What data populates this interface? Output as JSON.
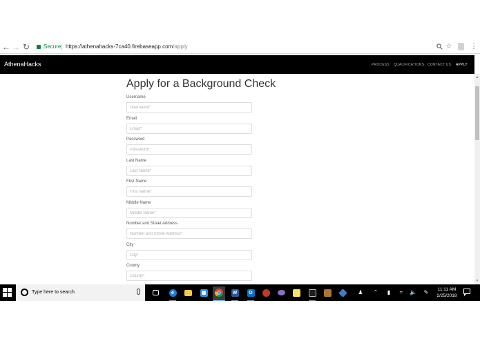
{
  "browser": {
    "back_icon": "arrow-left-icon",
    "forward_icon": "arrow-right-icon",
    "reload_icon": "reload-icon",
    "secure_label": "Secure",
    "url_host": "https://athenahacks-7ca40.firebaseapp.com",
    "url_path": "/apply",
    "zoom_icon": "zoom-icon",
    "bookmark_icon": "star-icon",
    "menu_icon": "kebab-menu-icon"
  },
  "site_nav": {
    "brand": "AthenaHacks",
    "links": [
      "PROCESS",
      "QUALIFICATIONS",
      "CONTACT US",
      "APPLY"
    ],
    "active_link": "APPLY"
  },
  "form": {
    "title": "Apply for a Background Check",
    "fields": [
      {
        "label": "Username",
        "placeholder": "Username*"
      },
      {
        "label": "Email",
        "placeholder": "Email*"
      },
      {
        "label": "Password",
        "placeholder": "Password*"
      },
      {
        "label": "Last Name",
        "placeholder": "Last Name*"
      },
      {
        "label": "First Name",
        "placeholder": "First Name*"
      },
      {
        "label": "Middle Name",
        "placeholder": "Middle Name*"
      },
      {
        "label": "Number and Street Address",
        "placeholder": "Number and Street Address*"
      },
      {
        "label": "City",
        "placeholder": "City*"
      },
      {
        "label": "County",
        "placeholder": "County*"
      }
    ]
  },
  "taskbar": {
    "search_placeholder": "Type here to search",
    "apps": [
      "task-view",
      "edge",
      "file-explorer",
      "store",
      "chrome",
      "word",
      "outlook",
      "paint",
      "app",
      "sticky-notes",
      "terminal",
      "app",
      "virtualbox"
    ],
    "active_app": "chrome",
    "clock_time": "11:11 AM",
    "clock_date": "2/25/2018"
  }
}
